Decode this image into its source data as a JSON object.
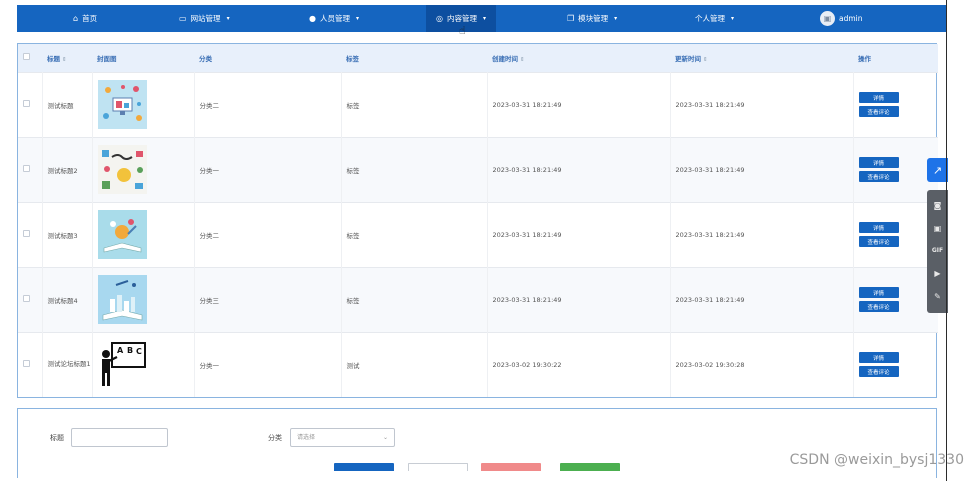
{
  "nav": {
    "items": [
      {
        "label": "首页",
        "icon": "home-icon",
        "glyph": "⌂",
        "caret": false,
        "active": false
      },
      {
        "label": "网站管理",
        "icon": "monitor-icon",
        "glyph": "▭",
        "caret": true,
        "active": false
      },
      {
        "label": "人员管理",
        "icon": "user-icon",
        "glyph": "●",
        "caret": true,
        "active": false
      },
      {
        "label": "内容管理",
        "icon": "chat-icon",
        "glyph": "◎",
        "caret": true,
        "active": true
      },
      {
        "label": "模块管理",
        "icon": "copy-icon",
        "glyph": "❐",
        "caret": true,
        "active": false
      },
      {
        "label": "个人管理",
        "icon": "",
        "glyph": "",
        "caret": true,
        "active": false
      }
    ],
    "user": "admin"
  },
  "table": {
    "headers": [
      "标题",
      "封面图",
      "分类",
      "标签",
      "创建时间",
      "更新时间",
      "操作"
    ],
    "rows": [
      {
        "title": "测试标题",
        "cover": "cover-image-1",
        "category": "分类二",
        "tag": "标签",
        "created": "2023-03-31 18:21:49",
        "updated": "2023-03-31 18:21:49"
      },
      {
        "title": "测试标题2",
        "cover": "cover-image-2",
        "category": "分类一",
        "tag": "标签",
        "created": "2023-03-31 18:21:49",
        "updated": "2023-03-31 18:21:49"
      },
      {
        "title": "测试标题3",
        "cover": "cover-image-3",
        "category": "分类二",
        "tag": "标签",
        "created": "2023-03-31 18:21:49",
        "updated": "2023-03-31 18:21:49"
      },
      {
        "title": "测试标题4",
        "cover": "cover-image-4",
        "category": "分类三",
        "tag": "标签",
        "created": "2023-03-31 18:21:49",
        "updated": "2023-03-31 18:21:49"
      },
      {
        "title": "测试论坛标题1",
        "cover": "cover-image-5",
        "category": "分类一",
        "tag": "测试",
        "created": "2023-03-02 19:30:22",
        "updated": "2023-03-02 19:30:28"
      }
    ],
    "actions": {
      "detail": "详情",
      "comments": "查看评论"
    }
  },
  "search": {
    "title_label": "标题",
    "category_label": "分类",
    "category_placeholder": "请选择"
  },
  "watermark": "CSDN @weixin_bysj1330",
  "colors": {
    "primary": "#1565c0",
    "danger": "#f08a8a",
    "success": "#4caf50"
  }
}
